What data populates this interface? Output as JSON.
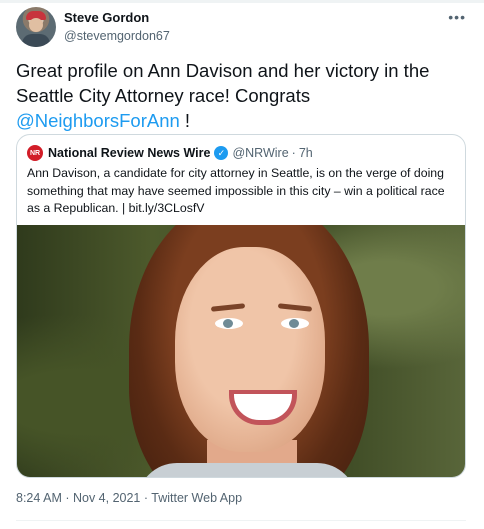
{
  "author": {
    "display_name": "Steve Gordon",
    "handle": "@stevemgordon67"
  },
  "tweet": {
    "text_part1": "Great profile on Ann Davison and her victory in the Seattle City Attorney race! Congrats ",
    "mention": "@NeighborsForAnn",
    "text_part2": " !",
    "timestamp": "8:24 AM · Nov 4, 2021 · Twitter Web App"
  },
  "quote": {
    "logo_text": "NR",
    "name": "National Review News Wire",
    "verified_icon": "✓",
    "handle": "@NRWire",
    "dot": "·",
    "time": "7h",
    "text": "Ann Davison, a candidate for city attorney in Seattle, is on the verge of doing something that may have seemed impossible in this city – win a political race as a Republican. | bit.ly/3CLosfV"
  },
  "icons": {
    "more": "•••"
  },
  "colors": {
    "accent": "#1d9bf0",
    "text": "#0f1419",
    "muted": "#536471",
    "border": "#cfd9de",
    "nr_red": "#d21d28"
  }
}
